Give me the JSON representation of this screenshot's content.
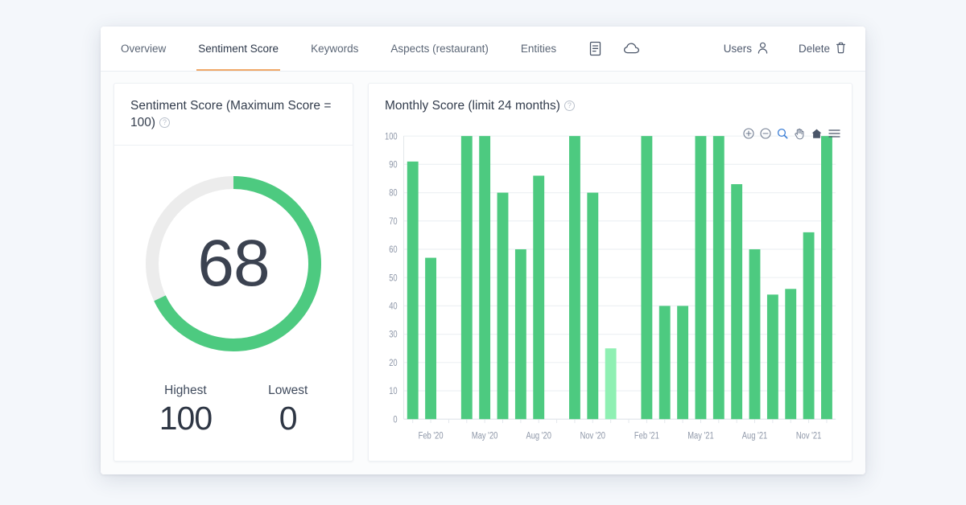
{
  "tabs": [
    {
      "label": "Overview",
      "active": false
    },
    {
      "label": "Sentiment Score",
      "active": true
    },
    {
      "label": "Keywords",
      "active": false
    },
    {
      "label": "Aspects (restaurant)",
      "active": false
    },
    {
      "label": "Entities",
      "active": false
    }
  ],
  "top_icons": [
    {
      "name": "document-icon"
    },
    {
      "name": "cloud-icon"
    }
  ],
  "top_actions": [
    {
      "label": "Users",
      "icon": "user-icon"
    },
    {
      "label": "Delete",
      "icon": "trash-icon"
    }
  ],
  "gauge_card": {
    "title": "Sentiment Score (Maximum Score = 100)",
    "help": "?",
    "score": "68",
    "score_value": 68,
    "max": 100,
    "stats": [
      {
        "label": "Highest",
        "value": "100"
      },
      {
        "label": "Lowest",
        "value": "0"
      }
    ]
  },
  "chart_card": {
    "title": "Monthly Score (limit 24 months)",
    "help": "?",
    "toolbar": [
      {
        "name": "zoom-in-icon",
        "active": false
      },
      {
        "name": "zoom-out-icon",
        "active": false
      },
      {
        "name": "selection-zoom-icon",
        "active": true
      },
      {
        "name": "panning-icon",
        "active": false
      },
      {
        "name": "reset-zoom-icon",
        "active": false
      },
      {
        "name": "menu-icon",
        "active": false
      }
    ]
  },
  "colors": {
    "bar": "#4dca80",
    "bar_highlight": "#8ff0b3",
    "gauge_track": "#ececec",
    "gauge_fill": "#4dca80",
    "accent": "#f0a868"
  },
  "chart_data": {
    "type": "bar",
    "title": "Monthly Score (limit 24 months)",
    "xlabel": "",
    "ylabel": "",
    "ylim": [
      0,
      100
    ],
    "yticks": [
      0,
      10,
      20,
      30,
      40,
      50,
      60,
      70,
      80,
      90,
      100
    ],
    "grid": true,
    "legend": "none",
    "tick_labels": [
      "Feb '20",
      "May '20",
      "Aug '20",
      "Nov '20",
      "Feb '21",
      "May '21",
      "Aug '21",
      "Nov '21"
    ],
    "tick_indices": [
      1,
      4,
      7,
      10,
      13,
      16,
      19,
      22
    ],
    "categories": [
      "Jan '20",
      "Feb '20",
      "Mar '20",
      "Apr '20",
      "May '20",
      "Jun '20",
      "Jul '20",
      "Aug '20",
      "Sep '20",
      "Oct '20",
      "Nov '20",
      "Dec '20",
      "Jan '21",
      "Feb '21",
      "Mar '21",
      "Apr '21",
      "May '21",
      "Jun '21",
      "Jul '21",
      "Aug '21",
      "Sep '21",
      "Oct '21",
      "Nov '21",
      "Dec '21"
    ],
    "values": [
      91,
      57,
      null,
      100,
      100,
      80,
      60,
      86,
      null,
      100,
      80,
      25,
      null,
      100,
      40,
      40,
      100,
      100,
      83,
      60,
      44,
      46,
      66,
      100
    ],
    "highlight_index": 11,
    "bar_color": "#4dca80",
    "highlight_color": "#8ff0b3"
  }
}
